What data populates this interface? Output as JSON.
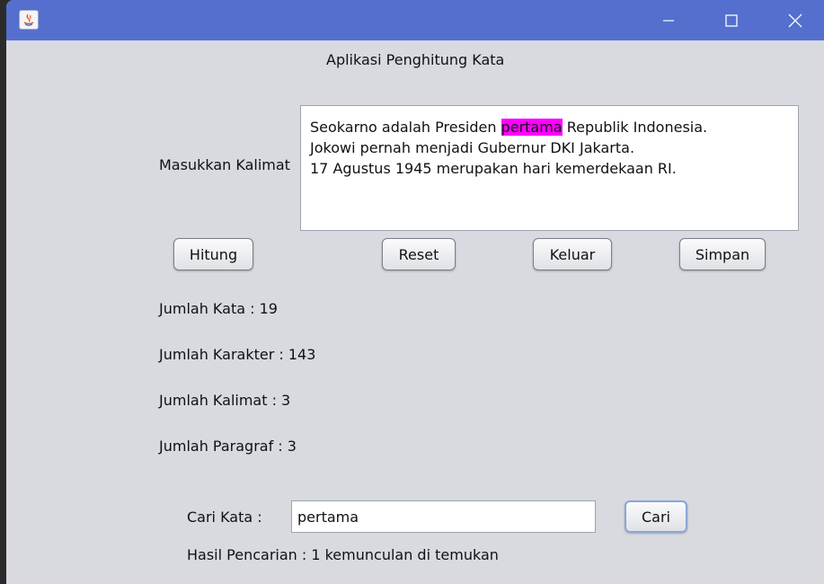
{
  "window": {
    "title": "",
    "titlebar_color": "#546fce",
    "background_color": "#d8dae0"
  },
  "header": {
    "title": "Aplikasi Penghitung Kata"
  },
  "input": {
    "label": "Masukkan Kalimat",
    "line1_before": "Seokarno adalah Presiden ",
    "line1_highlight": "pertama",
    "line1_after": " Republik Indonesia.",
    "line2": "Jokowi pernah menjadi Gubernur DKI Jakarta.",
    "line3": "17 Agustus 1945 merupakan hari kemerdekaan RI.",
    "highlight_color": "#ff00ff"
  },
  "buttons": {
    "hitung": "Hitung",
    "reset": "Reset",
    "keluar": "Keluar",
    "simpan": "Simpan",
    "cari": "Cari"
  },
  "stats": {
    "kata": "Jumlah Kata : 19",
    "karakter": "Jumlah Karakter : 143",
    "kalimat": "Jumlah Kalimat : 3",
    "paragraf": "Jumlah Paragraf : 3"
  },
  "search": {
    "label": "Cari Kata :",
    "value": "pertama",
    "result": "Hasil Pencarian : 1 kemunculan di temukan"
  }
}
